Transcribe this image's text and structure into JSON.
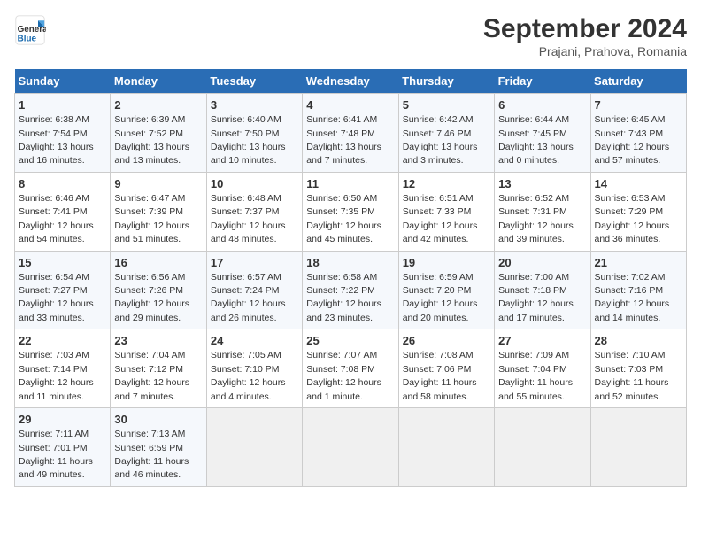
{
  "logo": {
    "line1": "General",
    "line2": "Blue"
  },
  "title": "September 2024",
  "subtitle": "Prajani, Prahova, Romania",
  "days_of_week": [
    "Sunday",
    "Monday",
    "Tuesday",
    "Wednesday",
    "Thursday",
    "Friday",
    "Saturday"
  ],
  "weeks": [
    [
      {
        "day": "1",
        "info": "Sunrise: 6:38 AM\nSunset: 7:54 PM\nDaylight: 13 hours and 16 minutes."
      },
      {
        "day": "2",
        "info": "Sunrise: 6:39 AM\nSunset: 7:52 PM\nDaylight: 13 hours and 13 minutes."
      },
      {
        "day": "3",
        "info": "Sunrise: 6:40 AM\nSunset: 7:50 PM\nDaylight: 13 hours and 10 minutes."
      },
      {
        "day": "4",
        "info": "Sunrise: 6:41 AM\nSunset: 7:48 PM\nDaylight: 13 hours and 7 minutes."
      },
      {
        "day": "5",
        "info": "Sunrise: 6:42 AM\nSunset: 7:46 PM\nDaylight: 13 hours and 3 minutes."
      },
      {
        "day": "6",
        "info": "Sunrise: 6:44 AM\nSunset: 7:45 PM\nDaylight: 13 hours and 0 minutes."
      },
      {
        "day": "7",
        "info": "Sunrise: 6:45 AM\nSunset: 7:43 PM\nDaylight: 12 hours and 57 minutes."
      }
    ],
    [
      {
        "day": "8",
        "info": "Sunrise: 6:46 AM\nSunset: 7:41 PM\nDaylight: 12 hours and 54 minutes."
      },
      {
        "day": "9",
        "info": "Sunrise: 6:47 AM\nSunset: 7:39 PM\nDaylight: 12 hours and 51 minutes."
      },
      {
        "day": "10",
        "info": "Sunrise: 6:48 AM\nSunset: 7:37 PM\nDaylight: 12 hours and 48 minutes."
      },
      {
        "day": "11",
        "info": "Sunrise: 6:50 AM\nSunset: 7:35 PM\nDaylight: 12 hours and 45 minutes."
      },
      {
        "day": "12",
        "info": "Sunrise: 6:51 AM\nSunset: 7:33 PM\nDaylight: 12 hours and 42 minutes."
      },
      {
        "day": "13",
        "info": "Sunrise: 6:52 AM\nSunset: 7:31 PM\nDaylight: 12 hours and 39 minutes."
      },
      {
        "day": "14",
        "info": "Sunrise: 6:53 AM\nSunset: 7:29 PM\nDaylight: 12 hours and 36 minutes."
      }
    ],
    [
      {
        "day": "15",
        "info": "Sunrise: 6:54 AM\nSunset: 7:27 PM\nDaylight: 12 hours and 33 minutes."
      },
      {
        "day": "16",
        "info": "Sunrise: 6:56 AM\nSunset: 7:26 PM\nDaylight: 12 hours and 29 minutes."
      },
      {
        "day": "17",
        "info": "Sunrise: 6:57 AM\nSunset: 7:24 PM\nDaylight: 12 hours and 26 minutes."
      },
      {
        "day": "18",
        "info": "Sunrise: 6:58 AM\nSunset: 7:22 PM\nDaylight: 12 hours and 23 minutes."
      },
      {
        "day": "19",
        "info": "Sunrise: 6:59 AM\nSunset: 7:20 PM\nDaylight: 12 hours and 20 minutes."
      },
      {
        "day": "20",
        "info": "Sunrise: 7:00 AM\nSunset: 7:18 PM\nDaylight: 12 hours and 17 minutes."
      },
      {
        "day": "21",
        "info": "Sunrise: 7:02 AM\nSunset: 7:16 PM\nDaylight: 12 hours and 14 minutes."
      }
    ],
    [
      {
        "day": "22",
        "info": "Sunrise: 7:03 AM\nSunset: 7:14 PM\nDaylight: 12 hours and 11 minutes."
      },
      {
        "day": "23",
        "info": "Sunrise: 7:04 AM\nSunset: 7:12 PM\nDaylight: 12 hours and 7 minutes."
      },
      {
        "day": "24",
        "info": "Sunrise: 7:05 AM\nSunset: 7:10 PM\nDaylight: 12 hours and 4 minutes."
      },
      {
        "day": "25",
        "info": "Sunrise: 7:07 AM\nSunset: 7:08 PM\nDaylight: 12 hours and 1 minute."
      },
      {
        "day": "26",
        "info": "Sunrise: 7:08 AM\nSunset: 7:06 PM\nDaylight: 11 hours and 58 minutes."
      },
      {
        "day": "27",
        "info": "Sunrise: 7:09 AM\nSunset: 7:04 PM\nDaylight: 11 hours and 55 minutes."
      },
      {
        "day": "28",
        "info": "Sunrise: 7:10 AM\nSunset: 7:03 PM\nDaylight: 11 hours and 52 minutes."
      }
    ],
    [
      {
        "day": "29",
        "info": "Sunrise: 7:11 AM\nSunset: 7:01 PM\nDaylight: 11 hours and 49 minutes."
      },
      {
        "day": "30",
        "info": "Sunrise: 7:13 AM\nSunset: 6:59 PM\nDaylight: 11 hours and 46 minutes."
      },
      null,
      null,
      null,
      null,
      null
    ]
  ]
}
